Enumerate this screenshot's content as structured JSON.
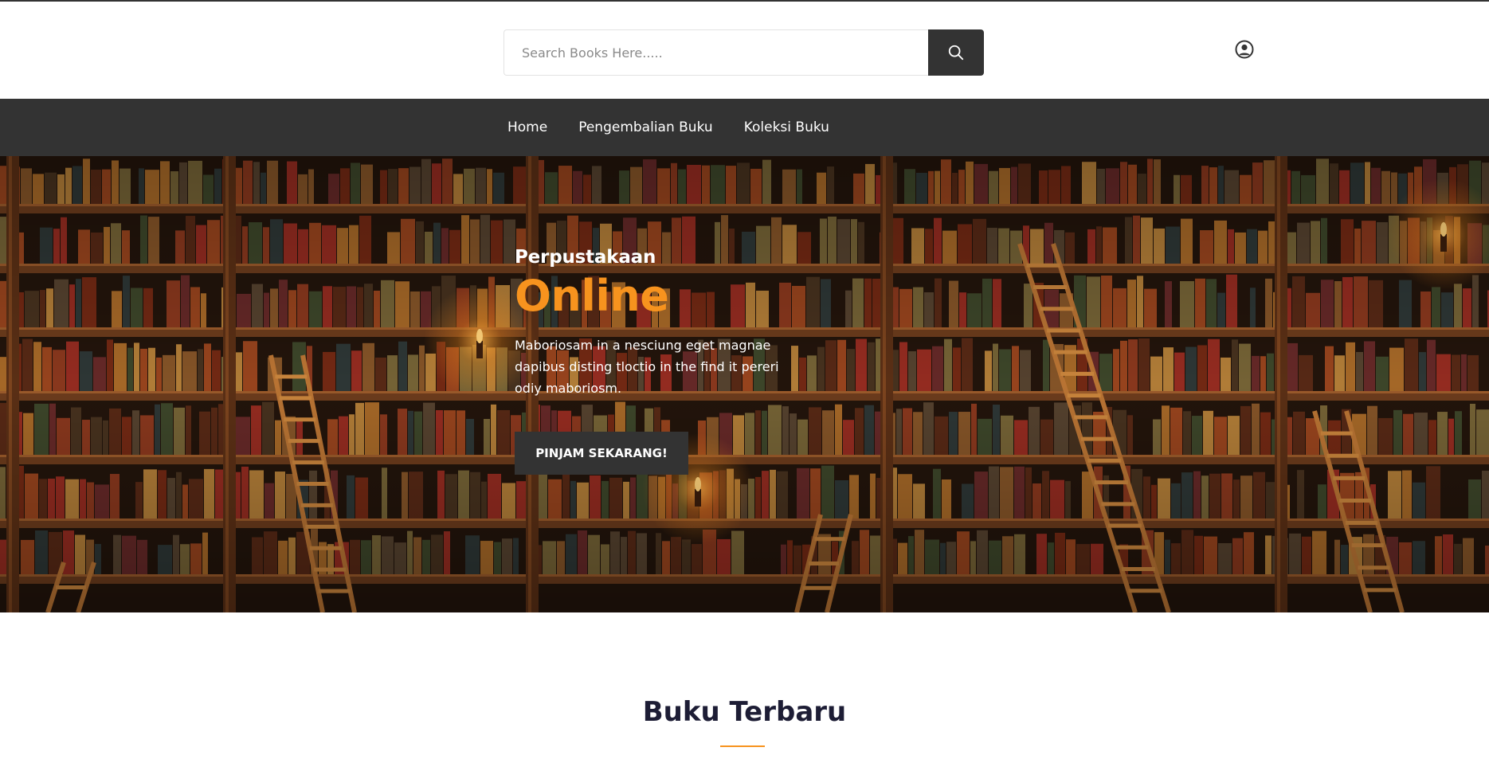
{
  "search": {
    "placeholder": "Search Books Here.....",
    "value": ""
  },
  "nav": {
    "items": [
      {
        "label": "Home"
      },
      {
        "label": "Pengembalian Buku"
      },
      {
        "label": "Koleksi Buku"
      }
    ]
  },
  "hero": {
    "eyebrow": "Perpustakaan",
    "title": "Online",
    "description": "Maboriosam in a nesciung eget magnae dapibus disting tloctio in the find it pereri odiy maboriosm.",
    "cta_label": "PINJAM SEKARANG!"
  },
  "section": {
    "title": "Buku Terbaru"
  },
  "icons": {
    "search": "search-icon",
    "user": "user-circle-icon"
  },
  "colors": {
    "accent": "#f7931e",
    "dark": "#333333",
    "heading": "#1d1d35"
  }
}
